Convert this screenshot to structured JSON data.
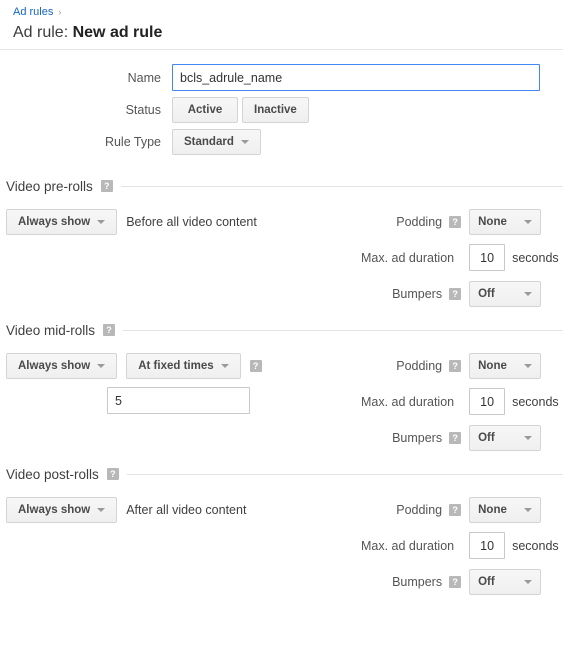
{
  "header": {
    "breadcrumb_label": "Ad rules",
    "breadcrumb_sep": "›",
    "title_prefix": "Ad rule:",
    "title_value": "New ad rule"
  },
  "form": {
    "name_label": "Name",
    "name_value": "bcls_adrule_name",
    "status_label": "Status",
    "status_active": "Active",
    "status_inactive": "Inactive",
    "rule_type_label": "Rule Type",
    "rule_type_value": "Standard"
  },
  "common": {
    "help_glyph": "?",
    "podding_label": "Podding",
    "max_duration_label": "Max. ad duration",
    "bumpers_label": "Bumpers",
    "seconds_unit": "seconds"
  },
  "sections": [
    {
      "id": "pre-rolls",
      "title": "Video pre-rolls",
      "show_rule": "Always show",
      "description": "Before all video content",
      "podding_value": "None",
      "max_duration_value": "10",
      "bumpers_value": "Off"
    },
    {
      "id": "mid-rolls",
      "title": "Video mid-rolls",
      "show_rule": "Always show",
      "timing_mode": "At fixed times",
      "times_value": "5",
      "podding_value": "None",
      "max_duration_value": "10",
      "bumpers_value": "Off"
    },
    {
      "id": "post-rolls",
      "title": "Video post-rolls",
      "show_rule": "Always show",
      "description": "After all video content",
      "podding_value": "None",
      "max_duration_value": "10",
      "bumpers_value": "Off"
    }
  ],
  "colors": {
    "link": "#1565c0",
    "focus_border": "#4285f4",
    "help_badge": "#b8b8b8"
  }
}
